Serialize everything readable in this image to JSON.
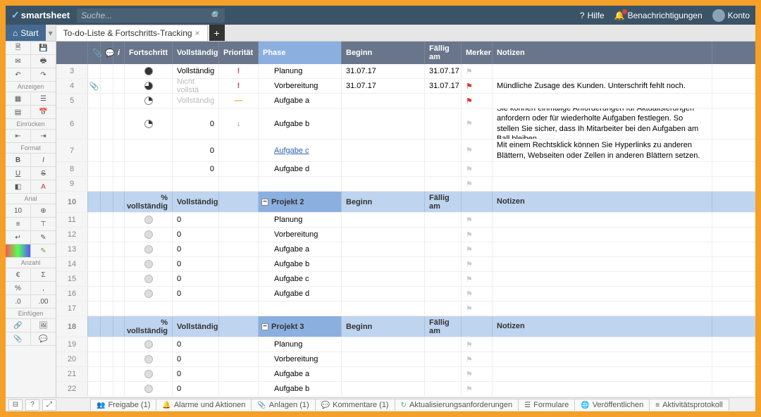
{
  "brand": {
    "name": "smartsheet"
  },
  "search": {
    "placeholder": "Suche..."
  },
  "topmenu": {
    "help": "Hilfe",
    "notifications": "Benachrichtigungen",
    "account": "Konto"
  },
  "tabs": {
    "start": "Start",
    "active": "To-do-Liste & Fortschritts-Tracking"
  },
  "sidebar_labels": {
    "anzeigen": "Anzeigen",
    "einruecken": "Einrücken",
    "format": "Format",
    "font": "Arial",
    "anzahl": "Anzahl",
    "einfuegen": "Einfügen"
  },
  "sidebar_size": "10",
  "columns": {
    "progress": "Fortschritt",
    "complete": "Vollständig",
    "priority": "Priorität",
    "phase": "Phase",
    "begin": "Beginn",
    "due": "Fällig am",
    "marker": "Merker",
    "notes": "Notizen",
    "pct_complete": "% vollständig"
  },
  "projects": {
    "p2": "Projekt 2",
    "p3": "Projekt 3"
  },
  "rows": [
    {
      "n": "3",
      "prog": "full",
      "compl": "Vollständig",
      "prio": "!",
      "prioCls": "prio-high",
      "phase": "Planung",
      "begin": "31.07.17",
      "due": "31.07.17",
      "flag": "gray",
      "notes": ""
    },
    {
      "n": "4",
      "attach": true,
      "prog": "p75",
      "compl": "Nicht vollstä",
      "complGray": true,
      "prio": "!",
      "prioCls": "prio-high",
      "phase": "Vorbereitung",
      "begin": "31.07.17",
      "due": "31.07.17",
      "flag": "red",
      "notes": "Mündliche Zusage des Kunden. Unterschrift fehlt noch."
    },
    {
      "n": "5",
      "prog": "p25",
      "compl": "Vollständig",
      "complGray": true,
      "prio": "—",
      "prioCls": "prio-med",
      "phase": "Aufgabe a",
      "flag": "red",
      "notes": ""
    },
    {
      "n": "6",
      "tall": true,
      "prog": "p25",
      "compl": "0",
      "complRight": true,
      "prio": "↓",
      "prioCls": "prio-low",
      "phase": "Aufgabe b",
      "flag": "gray",
      "notes": "Sie können einmalige Anforderungen für Aktualisierungen anfordern oder für wiederholte Aufgaben festlegen. So stellen Sie sicher, dass Ih Mitarbeiter bei den Aufgaben am Ball bleiben."
    },
    {
      "n": "7",
      "tall2": true,
      "compl": "0",
      "complRight": true,
      "phase": "Aufgabe c",
      "phaseLink": true,
      "flag": "gray",
      "notes": "Mit einem Rechtsklick können Sie Hyperlinks zu anderen Blättern, Webseiten oder Zellen in anderen Blättern setzen."
    },
    {
      "n": "8",
      "compl": "0",
      "complRight": true,
      "phase": "Aufgabe d",
      "flag": "gray"
    },
    {
      "n": "9",
      "flag": "gray"
    }
  ],
  "p2rows": [
    {
      "n": "11",
      "prog": "empty",
      "compl": "0",
      "phase": "Planung",
      "flag": "gray"
    },
    {
      "n": "12",
      "prog": "empty",
      "compl": "0",
      "phase": "Vorbereitung",
      "flag": "gray"
    },
    {
      "n": "13",
      "prog": "empty",
      "compl": "0",
      "phase": "Aufgabe a",
      "flag": "gray"
    },
    {
      "n": "14",
      "prog": "empty",
      "compl": "0",
      "phase": "Aufgabe b",
      "flag": "gray"
    },
    {
      "n": "15",
      "prog": "empty",
      "compl": "0",
      "phase": "Aufgabe c",
      "flag": "gray"
    },
    {
      "n": "16",
      "prog": "empty",
      "compl": "0",
      "phase": "Aufgabe d",
      "flag": "gray"
    },
    {
      "n": "17",
      "flag": "gray"
    }
  ],
  "p3rows": [
    {
      "n": "19",
      "prog": "empty",
      "compl": "0",
      "phase": "Planung",
      "flag": "gray"
    },
    {
      "n": "20",
      "prog": "empty",
      "compl": "0",
      "phase": "Vorbereitung",
      "flag": "gray"
    },
    {
      "n": "21",
      "prog": "empty",
      "compl": "0",
      "phase": "Aufgabe a",
      "flag": "gray"
    },
    {
      "n": "22",
      "prog": "empty",
      "compl": "0",
      "phase": "Aufgabe b",
      "flag": "gray"
    }
  ],
  "header_row_p2": "10",
  "header_row_p3": "18",
  "footer": {
    "freigabe": "Freigabe (1)",
    "alarme": "Alarme und Aktionen",
    "anlagen": "Anlagen (1)",
    "kommentare": "Kommentare (1)",
    "aktual": "Aktualisierungsanforderungen",
    "formulare": "Formulare",
    "veroeff": "Veröffentlichen",
    "protokoll": "Aktivitätsprotokoll"
  }
}
